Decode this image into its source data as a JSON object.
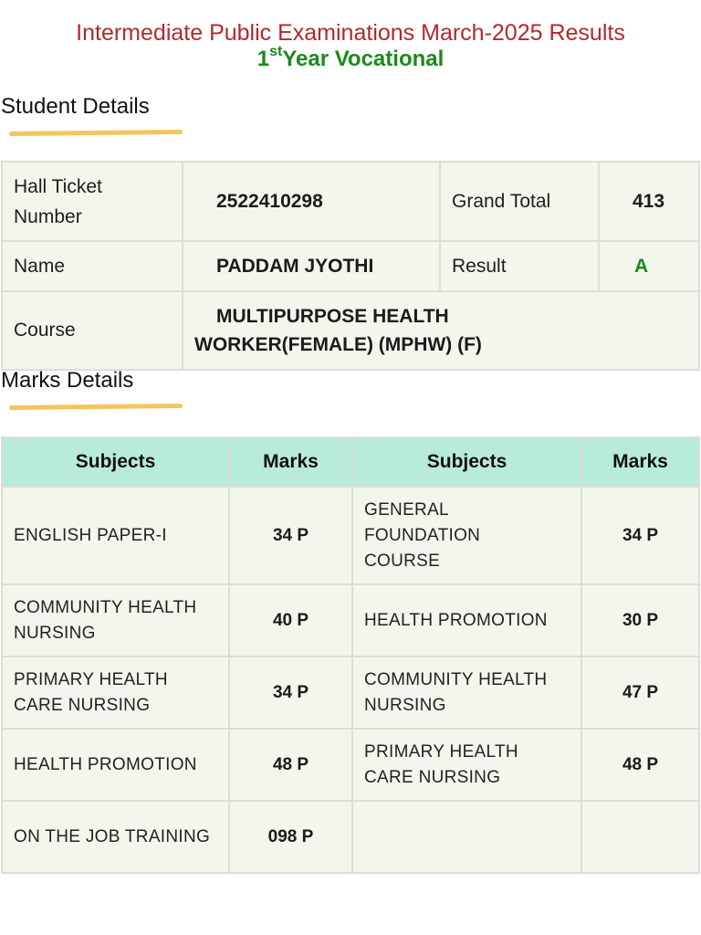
{
  "header": {
    "title": "Intermediate Public Examinations March-2025 Results",
    "year_ordinal": "1",
    "year_suffix": "st",
    "year_label": "Year Vocational"
  },
  "student_details": {
    "heading": "Student Details",
    "hall_ticket_label": "Hall Ticket Number",
    "hall_ticket_value": "2522410298",
    "grand_total_label": "Grand Total",
    "grand_total_value": "413",
    "name_label": "Name",
    "name_value": "PADDAM JYOTHI",
    "result_label": "Result",
    "result_value": "A",
    "course_label": "Course",
    "course_value": "MULTIPURPOSE HEALTH WORKER(FEMALE) (MPHW) (F)"
  },
  "marks_details": {
    "heading": "Marks Details",
    "columns": [
      "Subjects",
      "Marks",
      "Subjects",
      "Marks"
    ],
    "rows": [
      {
        "left_subject": "ENGLISH PAPER-I",
        "left_marks": "34 P",
        "right_subject": "GENERAL FOUNDATION COURSE",
        "right_marks": "34 P"
      },
      {
        "left_subject": "COMMUNITY HEALTH NURSING",
        "left_marks": "40 P",
        "right_subject": "HEALTH PROMOTION",
        "right_marks": "30 P"
      },
      {
        "left_subject": "PRIMARY HEALTH CARE NURSING",
        "left_marks": "34 P",
        "right_subject": "COMMUNITY HEALTH NURSING",
        "right_marks": "47 P"
      },
      {
        "left_subject": "HEALTH PROMOTION",
        "left_marks": "48 P",
        "right_subject": "PRIMARY HEALTH CARE NURSING",
        "right_marks": "48 P"
      },
      {
        "left_subject": "ON THE JOB TRAINING",
        "left_marks": "098 P",
        "right_subject": "",
        "right_marks": ""
      }
    ]
  },
  "colors": {
    "title": "#b3282d",
    "subtitle": "#1a8a1a",
    "underline": "#f3c55a",
    "table_bg": "#f3f6ec",
    "header_bg": "#b8ebdc"
  }
}
